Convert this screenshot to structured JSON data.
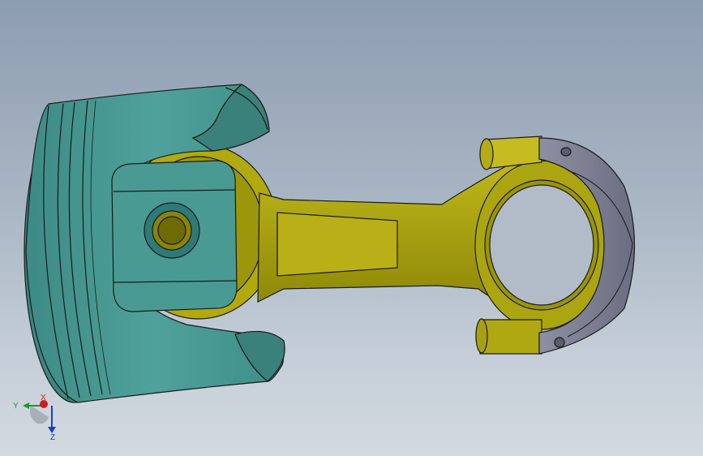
{
  "viewport": {
    "background_top": "#8d9db0",
    "background_bottom": "#d2d9e0"
  },
  "model": {
    "piston_color": "#4a9a94",
    "rod_color": "#a8a20a",
    "cap_color": "#7c8092",
    "edge_color": "#1a1a1a"
  },
  "triad": {
    "x_label": "X",
    "y_label": "Y",
    "z_label": "Z",
    "x_color": "#d01c1c",
    "y_color": "#1a9a2a",
    "z_color": "#1e3cc8"
  }
}
